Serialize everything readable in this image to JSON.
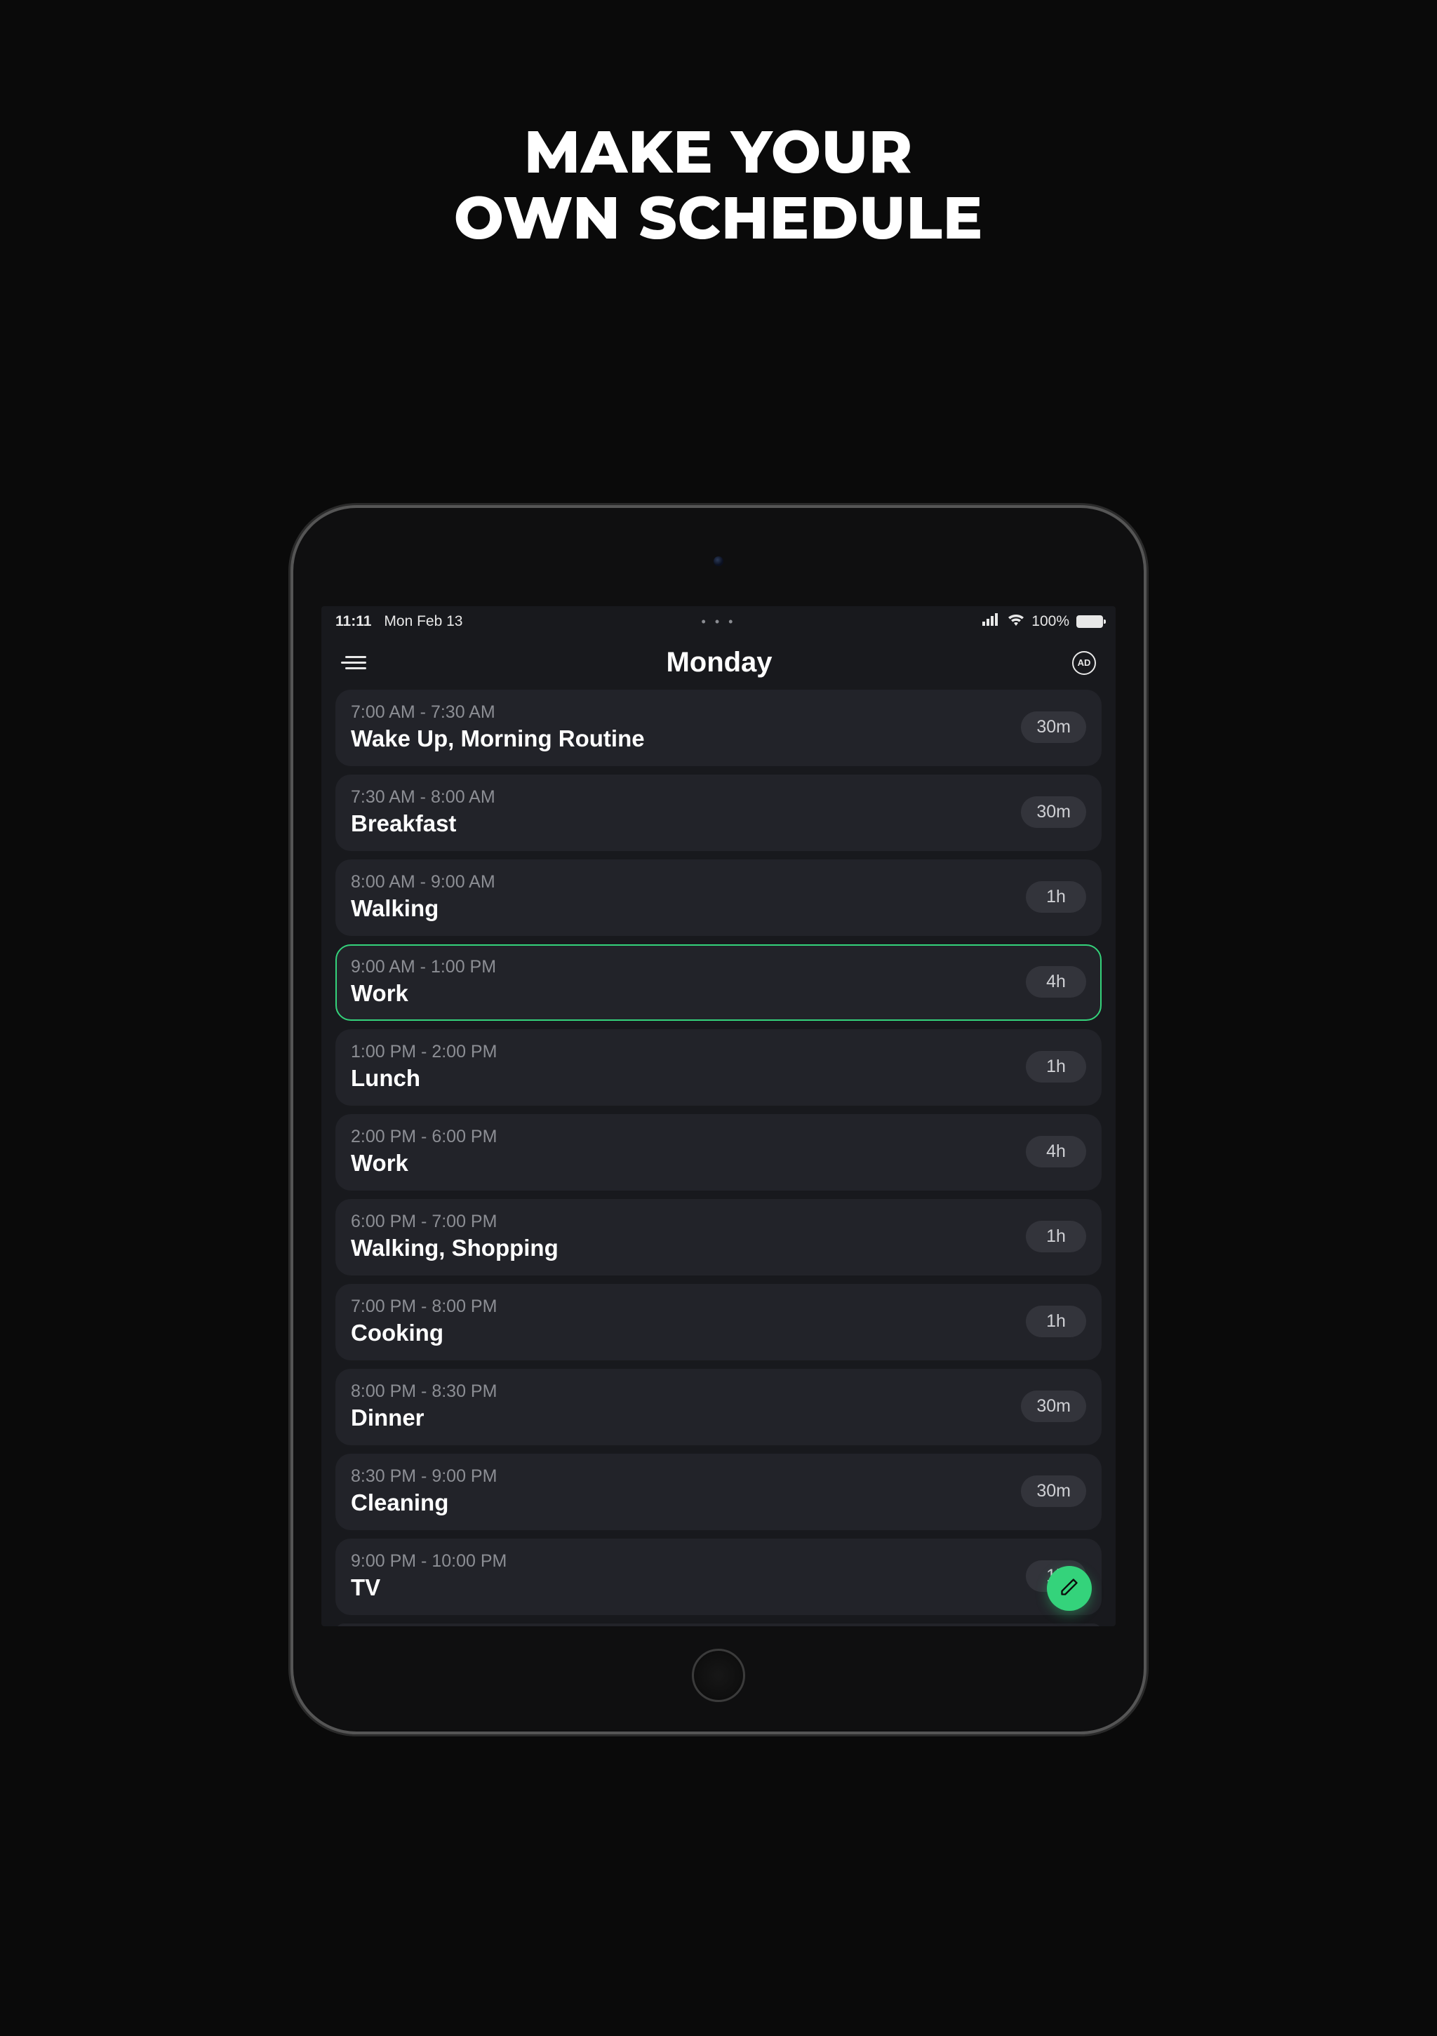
{
  "promo": {
    "line1": "MAKE YOUR",
    "line2": "OWN SCHEDULE"
  },
  "status": {
    "time": "11:11",
    "date": "Mon Feb 13",
    "battery_percent": "100%",
    "dots": "• • •"
  },
  "header": {
    "title": "Monday",
    "ad_label": "AD"
  },
  "events": [
    {
      "time": "7:00 AM - 7:30 AM",
      "title": "Wake Up, Morning Routine",
      "duration": "30m",
      "active": false
    },
    {
      "time": "7:30 AM - 8:00 AM",
      "title": "Breakfast",
      "duration": "30m",
      "active": false
    },
    {
      "time": "8:00 AM - 9:00 AM",
      "title": "Walking",
      "duration": "1h",
      "active": false
    },
    {
      "time": "9:00 AM - 1:00 PM",
      "title": "Work",
      "duration": "4h",
      "active": true
    },
    {
      "time": "1:00 PM - 2:00 PM",
      "title": "Lunch",
      "duration": "1h",
      "active": false
    },
    {
      "time": "2:00 PM - 6:00 PM",
      "title": "Work",
      "duration": "4h",
      "active": false
    },
    {
      "time": "6:00 PM - 7:00 PM",
      "title": "Walking, Shopping",
      "duration": "1h",
      "active": false
    },
    {
      "time": "7:00 PM - 8:00 PM",
      "title": "Cooking",
      "duration": "1h",
      "active": false
    },
    {
      "time": "8:00 PM - 8:30 PM",
      "title": "Dinner",
      "duration": "30m",
      "active": false
    },
    {
      "time": "8:30 PM - 9:00 PM",
      "title": "Cleaning",
      "duration": "30m",
      "active": false
    },
    {
      "time": "9:00 PM - 10:00 PM",
      "title": "TV",
      "duration": "1h",
      "active": false
    }
  ],
  "colors": {
    "accent": "#34d37b",
    "card": "#222329",
    "bg": "#18191d"
  }
}
